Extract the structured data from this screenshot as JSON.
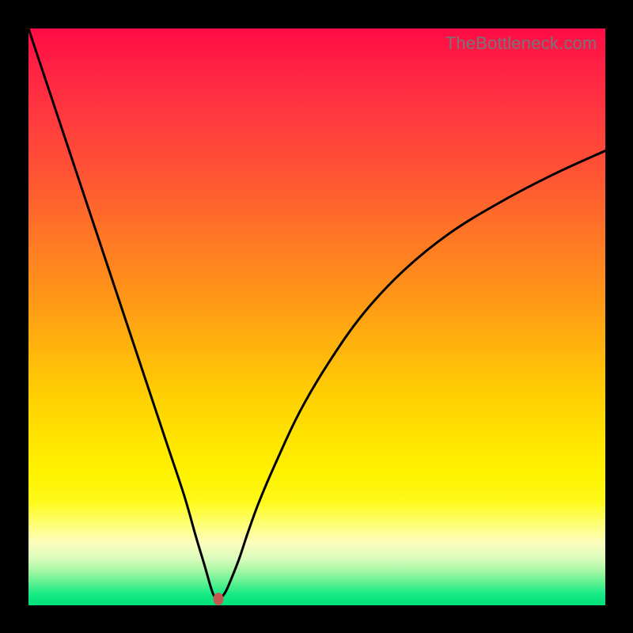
{
  "watermark": "TheBottleneck.com",
  "colors": {
    "frame": "#000000",
    "curve_stroke": "#000000",
    "marker_fill": "#c35a52"
  },
  "chart_data": {
    "type": "line",
    "title": "",
    "xlabel": "",
    "ylabel": "",
    "xlim": [
      0,
      100
    ],
    "ylim": [
      0,
      100
    ],
    "series": [
      {
        "name": "bottleneck-curve",
        "x": [
          0,
          3,
          6,
          9,
          12,
          15,
          18,
          21,
          24,
          27,
          29,
          30.5,
          31.5,
          32,
          32.5,
          33,
          33.5,
          34.2,
          35,
          36.5,
          38,
          40,
          43,
          47,
          52,
          58,
          65,
          73,
          82,
          91,
          100
        ],
        "y": [
          100,
          91,
          82,
          73,
          64,
          55,
          46,
          37,
          28,
          19,
          12,
          7,
          3.5,
          2,
          1.2,
          1,
          1.4,
          2.4,
          4.2,
          8,
          12.5,
          18,
          25,
          33.5,
          42,
          50.5,
          58,
          64.5,
          70,
          74.7,
          78.8
        ]
      }
    ],
    "annotations": [
      {
        "name": "optimum-marker",
        "x": 33,
        "y": 1
      }
    ],
    "grid": false,
    "legend": false
  }
}
